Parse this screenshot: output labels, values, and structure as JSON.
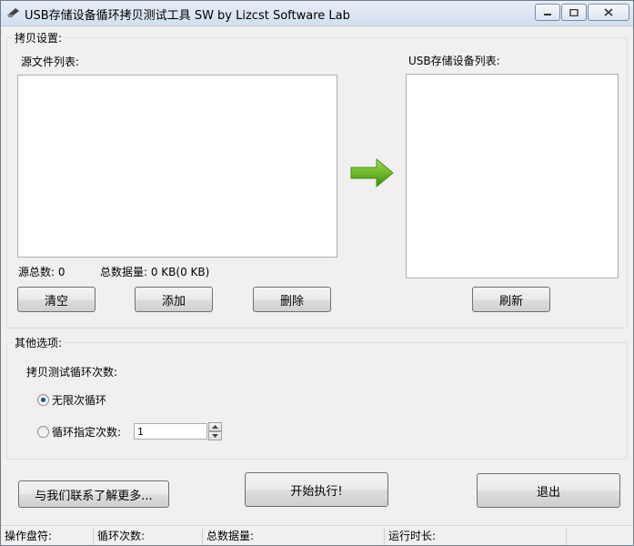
{
  "window": {
    "title": "USB存储设备循环拷贝测试工具 SW  by Lizcst Software Lab",
    "minimize_glyph": "▭",
    "maximize_glyph": "□",
    "close_glyph": "✕"
  },
  "copy_settings": {
    "legend": "拷贝设置:",
    "source_list_label": "源文件列表:",
    "usb_list_label": "USB存储设备列表:",
    "source_count": "源总数: 0",
    "total_size": "总数据量: 0 KB(0 KB)",
    "clear_label": "清空",
    "add_label": "添加",
    "delete_label": "删除",
    "refresh_label": "刷新",
    "arrow_color": "#5aa51e"
  },
  "other_options": {
    "legend": "其他选项:",
    "loop_label": "拷贝测试循环次数:",
    "infinite_label": "无限次循环",
    "specified_label": "循环指定次数:",
    "count_value": "1",
    "infinite_checked": true
  },
  "actions": {
    "contact_label": "与我们联系了解更多...",
    "start_label": "开始执行!",
    "exit_label": "退出"
  },
  "status": {
    "drive": "操作盘符:",
    "loops": "循环次数:",
    "total": "总数据量:",
    "runtime": "运行时长:"
  }
}
